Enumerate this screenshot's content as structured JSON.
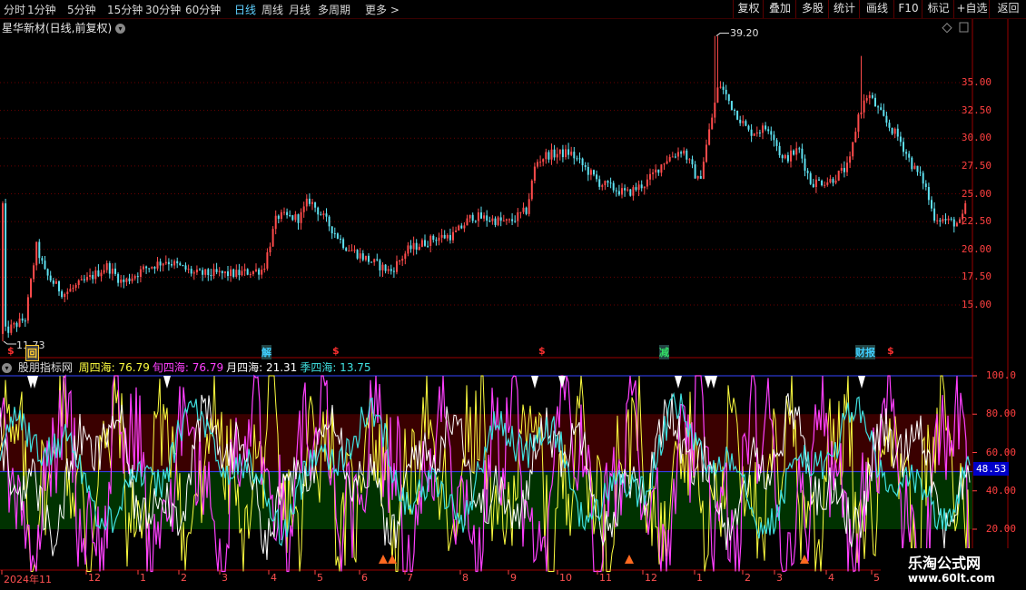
{
  "toolbar": {
    "periods": [
      "分时",
      "1分钟",
      "5分钟",
      "15分钟",
      "30分钟",
      "60分钟",
      "日线",
      "周线",
      "月线",
      "多周期",
      "更多 >"
    ],
    "active_period": "日线",
    "right_buttons": [
      "复权",
      "叠加",
      "多股",
      "统计",
      "画线",
      "F10",
      "标记",
      "+自选",
      "返回"
    ]
  },
  "price_panel": {
    "title": "星华新材(日线,前复权)",
    "y_ticks": [
      "35.00",
      "32.50",
      "30.00",
      "27.50",
      "25.00",
      "22.50",
      "20.00",
      "17.50",
      "15.00"
    ],
    "high_label": "39.20",
    "low_label": "11.73",
    "events": [
      {
        "t": "$",
        "color": "#ff3030"
      },
      {
        "t": "回",
        "color": "#ffcc33"
      },
      {
        "t": "解",
        "color": "#3fd0ff"
      },
      {
        "t": "$",
        "color": "#ff3030"
      },
      {
        "t": "$",
        "color": "#ff3030"
      },
      {
        "t": "减",
        "color": "#33dd66"
      },
      {
        "t": "财报",
        "color": "#3fd0ff"
      },
      {
        "t": "$",
        "color": "#ff3030"
      }
    ]
  },
  "indicator_panel": {
    "name": "股朋指标网",
    "items": [
      {
        "label": "周四海:",
        "value": "76.79",
        "color": "#ffff40"
      },
      {
        "label": "旬四海:",
        "value": "76.79",
        "color": "#ff40ff"
      },
      {
        "label": "月四海:",
        "value": "21.31",
        "color": "#ffffff"
      },
      {
        "label": "季四海:",
        "value": "13.75",
        "color": "#40e0e0"
      }
    ],
    "y_ticks": [
      "100.0",
      "80.00",
      "60.00",
      "40.00",
      "20.00"
    ],
    "current_value": "48.53"
  },
  "x_axis": {
    "labels": [
      "2024年11",
      "12",
      "1",
      "2",
      "3",
      "4",
      "5",
      "6",
      "7",
      "8",
      "9",
      "10",
      "11",
      "12",
      "1",
      "2",
      "3",
      "4",
      "5"
    ]
  },
  "watermark": {
    "line1": "乐淘公式网",
    "line2": "www.60lt.com"
  },
  "colors": {
    "up": "#ff4b4b",
    "down": "#5ee0f0",
    "grid": "#7a0000",
    "bg": "#000000"
  }
}
